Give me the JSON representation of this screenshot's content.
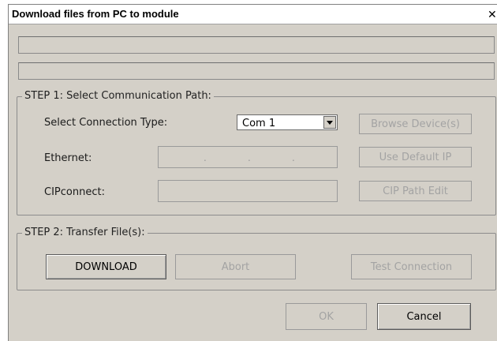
{
  "window": {
    "title": "Download files from PC to module",
    "close_icon": "close-icon",
    "close_glyph": "✕"
  },
  "status_fields": [
    "",
    ""
  ],
  "step1": {
    "legend": "STEP 1: Select Communication Path:",
    "connection_type_label": "Select Connection Type:",
    "connection_type_value": "Com 1",
    "browse_button": "Browse Device(s)",
    "ethernet_label": "Ethernet:",
    "ethernet_value": "",
    "ip_separators": ".",
    "use_default_ip_button": "Use Default IP",
    "cipconnect_label": "CIPconnect:",
    "cipconnect_value": "",
    "cip_path_edit_button": "CIP Path Edit"
  },
  "step2": {
    "legend": "STEP 2: Transfer File(s):",
    "download_button": "DOWNLOAD",
    "abort_button": "Abort",
    "test_connection_button": "Test Connection"
  },
  "footer": {
    "ok_button": "OK",
    "cancel_button": "Cancel"
  },
  "colors": {
    "dialog_bg": "#d4d0c8",
    "disabled_text": "#a3a3a3"
  }
}
